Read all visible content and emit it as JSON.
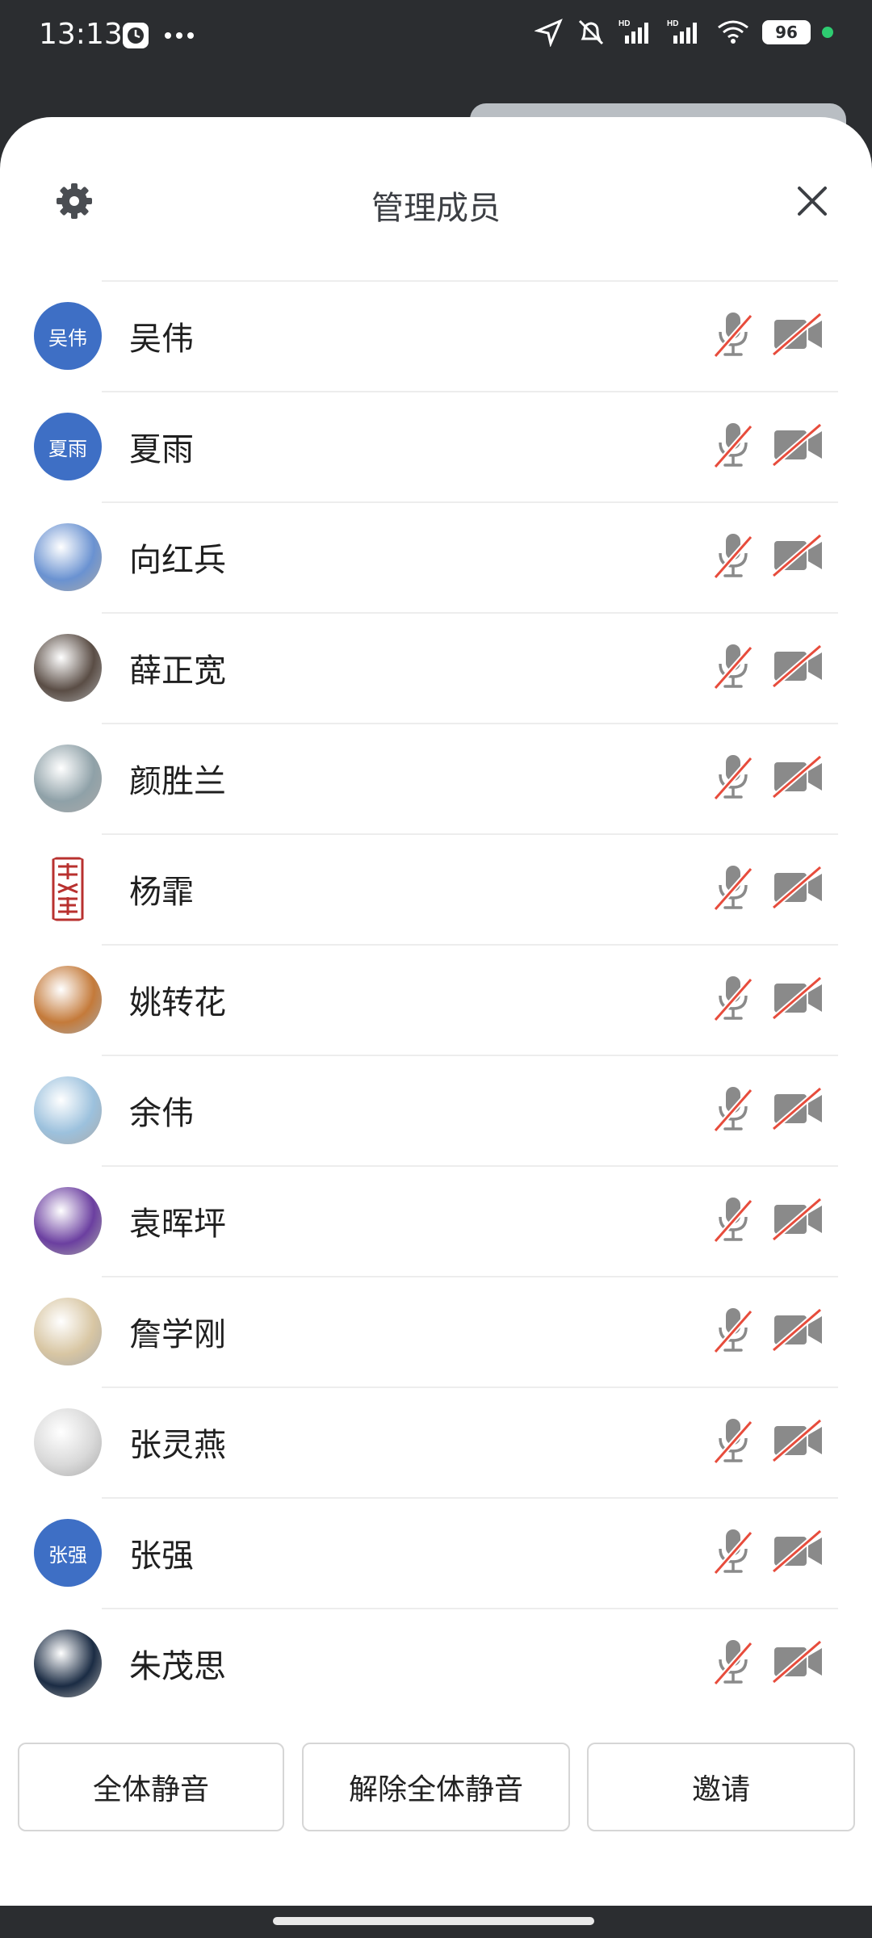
{
  "status": {
    "time": "13:13",
    "battery": "96",
    "network_label": "HD"
  },
  "header": {
    "title": "管理成员"
  },
  "members": [
    {
      "name": "吴伟",
      "avatar_text": "吴伟",
      "avatar_type": "text"
    },
    {
      "name": "夏雨",
      "avatar_text": "夏雨",
      "avatar_type": "text"
    },
    {
      "name": "向红兵",
      "avatar_type": "photo",
      "avatar_color": "#6a92d1"
    },
    {
      "name": "薛正宽",
      "avatar_type": "photo",
      "avatar_color": "#5a4d45"
    },
    {
      "name": "颜胜兰",
      "avatar_type": "photo",
      "avatar_color": "#8fa1a8"
    },
    {
      "name": "杨霏",
      "avatar_type": "seal",
      "avatar_color": "#b8312f"
    },
    {
      "name": "姚转花",
      "avatar_type": "photo",
      "avatar_color": "#c47a3a"
    },
    {
      "name": "余伟",
      "avatar_type": "photo",
      "avatar_color": "#9cc1dd"
    },
    {
      "name": "袁晖坪",
      "avatar_type": "photo",
      "avatar_color": "#6b3fa0"
    },
    {
      "name": "詹学刚",
      "avatar_type": "photo",
      "avatar_color": "#d8c6a3"
    },
    {
      "name": "张灵燕",
      "avatar_type": "photo",
      "avatar_color": "#d9d9d9"
    },
    {
      "name": "张强",
      "avatar_text": "张强",
      "avatar_type": "text"
    },
    {
      "name": "朱茂思",
      "avatar_type": "photo",
      "avatar_color": "#1b2c44"
    }
  ],
  "footer": {
    "mute_all": "全体静音",
    "unmute_all": "解除全体静音",
    "invite": "邀请"
  },
  "colors": {
    "accent": "#3e6fc5",
    "muted_red": "#e74c3c",
    "icon_gray": "#8a8a8a"
  }
}
